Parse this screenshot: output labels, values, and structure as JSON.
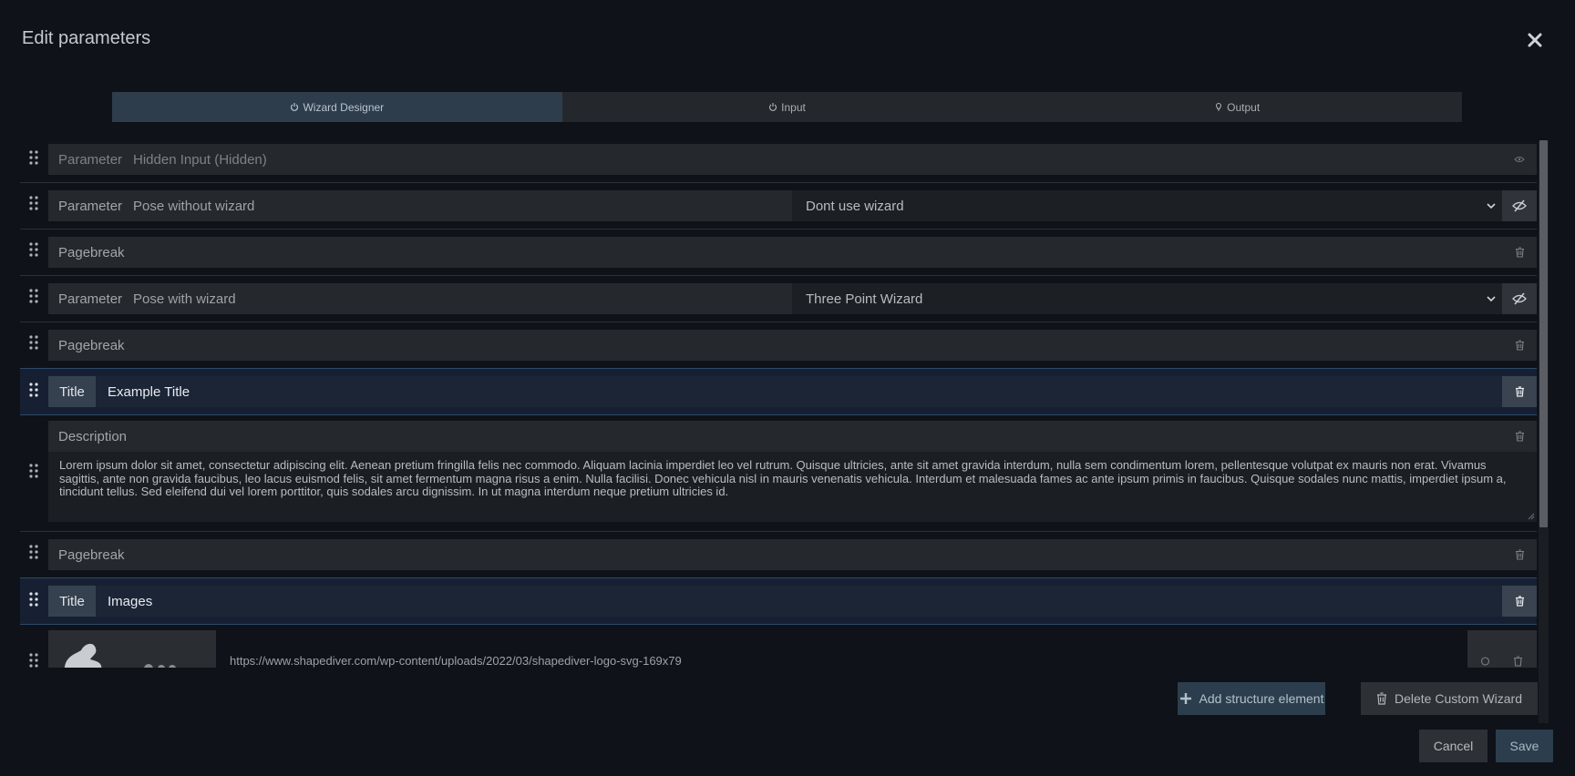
{
  "header": {
    "title": "Edit parameters"
  },
  "tabs": [
    {
      "label": "Wizard Designer",
      "icon": "power-icon"
    },
    {
      "label": "Input",
      "icon": "power-icon"
    },
    {
      "label": "Output",
      "icon": "bulb-icon"
    }
  ],
  "rows": [
    {
      "type": "parameter",
      "kind": "Parameter",
      "name": "Hidden Input (Hidden)"
    },
    {
      "type": "parameter",
      "kind": "Parameter",
      "name": "Pose without wizard",
      "wizard": "Dont use wizard"
    },
    {
      "type": "pagebreak",
      "kind": "Pagebreak"
    },
    {
      "type": "parameter",
      "kind": "Parameter",
      "name": "Pose with wizard",
      "wizard": "Three Point Wizard"
    },
    {
      "type": "pagebreak",
      "kind": "Pagebreak"
    },
    {
      "type": "title",
      "kind": "Title",
      "text": "Example Title"
    },
    {
      "type": "description",
      "kind": "Description",
      "text": "Lorem ipsum dolor sit amet, consectetur adipiscing elit. Aenean pretium fringilla felis nec commodo. Aliquam lacinia imperdiet leo vel rutrum. Quisque ultricies, ante sit amet gravida interdum, nulla sem condimentum lorem, pellentesque volutpat ex mauris non erat. Vivamus sagittis, ante non gravida faucibus, leo lacus euismod felis, sit amet fermentum magna risus a enim. Nulla facilisi. Donec vehicula nisl in mauris venenatis vehicula. Interdum et malesuada fames ac ante ipsum primis in faucibus. Quisque sodales nunc mattis, imperdiet ipsum a, tincidunt tellus. Sed eleifend dui vel lorem porttitor, quis sodales arcu dignissim. In ut magna interdum neque pretium ultricies id."
    },
    {
      "type": "pagebreak",
      "kind": "Pagebreak"
    },
    {
      "type": "title",
      "kind": "Title",
      "text": "Images"
    },
    {
      "type": "image",
      "url": "https://www.shapediver.com/wp-content/uploads/2022/03/shapediver-logo-svg-169x79"
    }
  ],
  "footer": {
    "add_label": "Add structure element",
    "delete_wizard_label": "Delete Custom Wizard",
    "cancel_label": "Cancel",
    "save_label": "Save"
  },
  "colors": {
    "background": "#0f1218",
    "active_tab": "#2e3d4b",
    "title_row": "#1b2536",
    "primary_button": "#2c3e4d"
  }
}
